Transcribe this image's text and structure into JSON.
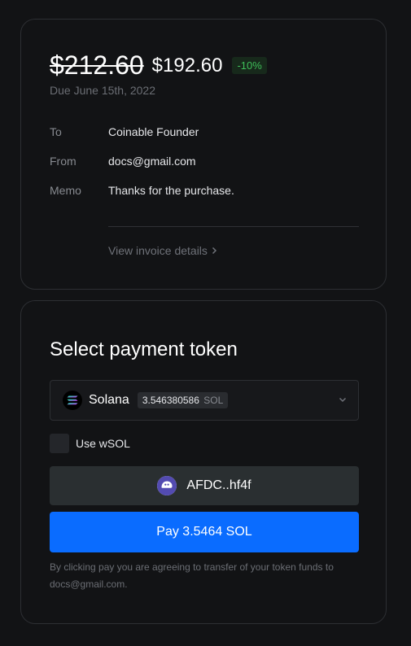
{
  "invoice": {
    "original_price": "$212.60",
    "price": "$192.60",
    "discount": "-10%",
    "due": "Due June 15th, 2022",
    "to_label": "To",
    "to_value": "Coinable Founder",
    "from_label": "From",
    "from_value": "docs@gmail.com",
    "memo_label": "Memo",
    "memo_value": "Thanks for the purchase.",
    "details_link": "View invoice details"
  },
  "payment": {
    "title": "Select payment token",
    "token_name": "Solana",
    "token_balance": "3.546380586",
    "token_unit": "SOL",
    "wsol_label": "Use wSOL",
    "wallet_address": "AFDC..hf4f",
    "pay_label": "Pay 3.5464 SOL",
    "disclaimer": "By clicking pay you are agreeing to transfer of your token funds to docs@gmail.com."
  },
  "colors": {
    "background": "#121315",
    "accent": "#0a6cff",
    "discount": "#3fbf5a"
  },
  "icons": [
    "solana-icon",
    "chevron-down-icon",
    "chevron-right-icon",
    "phantom-icon"
  ]
}
